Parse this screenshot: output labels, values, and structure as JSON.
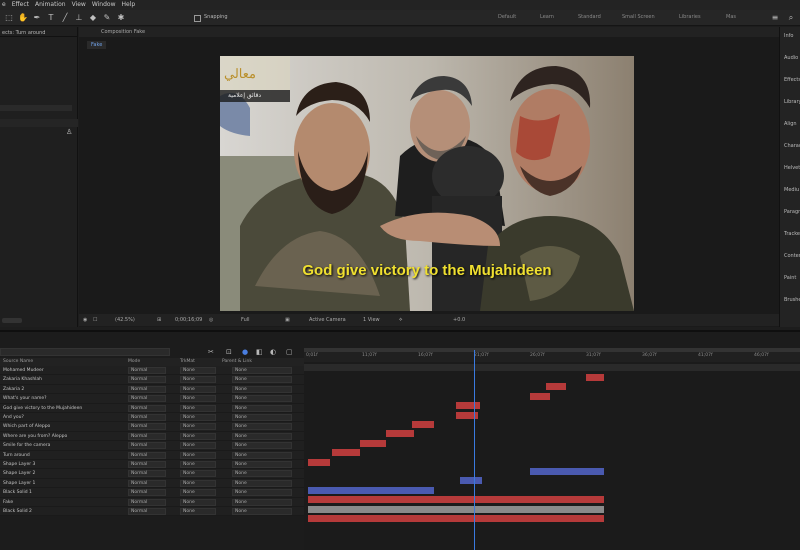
{
  "menu": [
    "Effect",
    "Animation",
    "View",
    "Window",
    "Help"
  ],
  "menu_prefix": "e",
  "toolbar": {
    "snapping_label": "Snapping",
    "workspaces": [
      "Default",
      "Learn",
      "Standard",
      "Small Screen",
      "Libraries",
      "Mas"
    ]
  },
  "left_panel": {
    "title": "ects: Turn around"
  },
  "comp_panel": {
    "tab_title": "Composition Fake",
    "breadcrumb": "Fake"
  },
  "right_panel": {
    "items": [
      "Info",
      "Audio",
      "Effects",
      "Library",
      "Align",
      "Charac",
      "Helvet",
      "Mediu",
      "Paragr",
      "Tracker",
      "Conten",
      "Paint",
      "Brushe"
    ]
  },
  "video": {
    "subtitle": "God give victory to the Mujahideen",
    "watermark_sub": "دقائق إعلامية"
  },
  "viewer_bar": {
    "zoom": "(42.5%)",
    "timecode": "0;00;16;09",
    "resolution": "Full",
    "camera": "Active Camera",
    "view": "1 View",
    "exposure": "+0.0"
  },
  "timeline": {
    "columns": {
      "name": "Source Name",
      "mode": "Mode",
      "trkmat": "TrkMat",
      "parent": "Parent & Link"
    },
    "ruler_labels": [
      "0;01f",
      "11;07f",
      "16;07f",
      "21;07f",
      "26;07f",
      "31;07f",
      "36;07f",
      "41;07f",
      "46;07f"
    ],
    "layers": [
      {
        "name": "Mohamed Mudeer",
        "mode": "Normal",
        "trkmat": "None",
        "parent": "None"
      },
      {
        "name": "Zakaria Khashlah",
        "mode": "Normal",
        "trkmat": "None",
        "parent": "None"
      },
      {
        "name": "Zakaria 2",
        "mode": "Normal",
        "trkmat": "None",
        "parent": "None"
      },
      {
        "name": "What's your name?",
        "mode": "Normal",
        "trkmat": "None",
        "parent": "None"
      },
      {
        "name": "God give victory  to the Mujahideen",
        "mode": "Normal",
        "trkmat": "None",
        "parent": "None"
      },
      {
        "name": "And you?",
        "mode": "Normal",
        "trkmat": "None",
        "parent": "None"
      },
      {
        "name": "Which part of Aleppo",
        "mode": "Normal",
        "trkmat": "None",
        "parent": "None"
      },
      {
        "name": "Where are you from? Aleppo",
        "mode": "Normal",
        "trkmat": "None",
        "parent": "None"
      },
      {
        "name": "Smile for the camera",
        "mode": "Normal",
        "trkmat": "None",
        "parent": "None"
      },
      {
        "name": "Turn around",
        "mode": "Normal",
        "trkmat": "None",
        "parent": "None"
      },
      {
        "name": "Shape Layer 3",
        "mode": "Normal",
        "trkmat": "None",
        "parent": "None"
      },
      {
        "name": "Shape Layer 2",
        "mode": "Normal",
        "trkmat": "None",
        "parent": "None"
      },
      {
        "name": "Shape Layer 1",
        "mode": "Normal",
        "trkmat": "None",
        "parent": "None"
      },
      {
        "name": "Black Solid 1",
        "mode": "Normal",
        "trkmat": "None",
        "parent": "None"
      },
      {
        "name": "Fake",
        "mode": "Normal",
        "trkmat": "None",
        "parent": "None"
      },
      {
        "name": "Black Solid 2",
        "mode": "Normal",
        "trkmat": "None",
        "parent": "None"
      }
    ]
  },
  "colors": {
    "red_layer": "#b63a3a",
    "blue_layer": "#4a5ab0",
    "gray_layer": "#8a8a8a",
    "playhead": "#3a7ae0"
  }
}
